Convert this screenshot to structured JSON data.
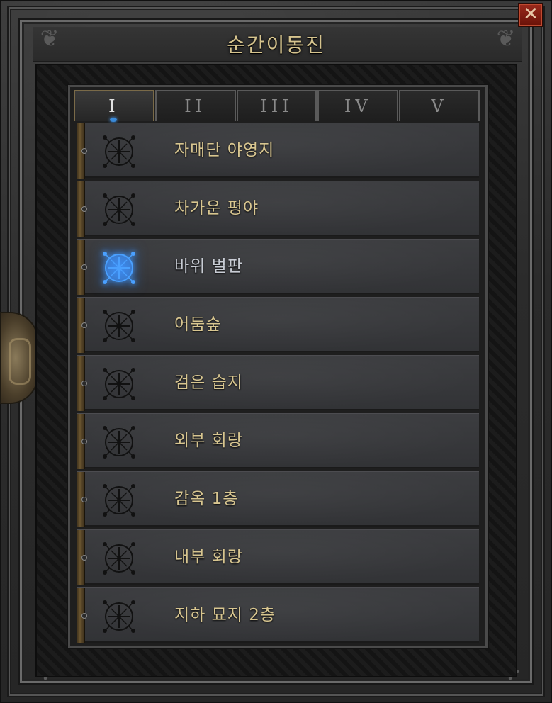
{
  "window": {
    "title": "순간이동진",
    "close_glyph": "✕"
  },
  "tabs": [
    {
      "label": "I",
      "active": true
    },
    {
      "label": "II",
      "active": false
    },
    {
      "label": "III",
      "active": false
    },
    {
      "label": "IV",
      "active": false
    },
    {
      "label": "V",
      "active": false
    }
  ],
  "waypoints": [
    {
      "name": "자매단 야영지",
      "current": false,
      "icon": "waypoint-icon"
    },
    {
      "name": "차가운 평야",
      "current": false,
      "icon": "waypoint-icon"
    },
    {
      "name": "바위 벌판",
      "current": true,
      "icon": "waypoint-icon-active"
    },
    {
      "name": "어둠숲",
      "current": false,
      "icon": "waypoint-icon"
    },
    {
      "name": "검은 습지",
      "current": false,
      "icon": "waypoint-icon"
    },
    {
      "name": "외부 회랑",
      "current": false,
      "icon": "waypoint-icon"
    },
    {
      "name": "감옥 1층",
      "current": false,
      "icon": "waypoint-icon"
    },
    {
      "name": "내부 회랑",
      "current": false,
      "icon": "waypoint-icon"
    },
    {
      "name": "지하 묘지 2층",
      "current": false,
      "icon": "waypoint-icon"
    }
  ],
  "colors": {
    "label_gold": "#d8c690",
    "label_current": "#c8ccd4",
    "icon_inactive": "#111111",
    "icon_active": "#4aa0ff",
    "close_red": "#8a2010"
  }
}
